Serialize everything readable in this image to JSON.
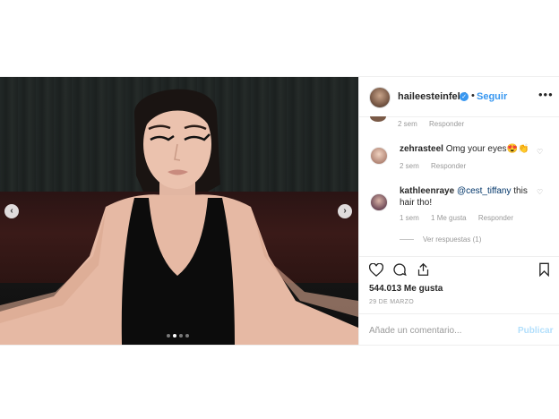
{
  "header": {
    "username": "haileesteinfeld",
    "separator": "•",
    "follow_label": "Seguir",
    "more_label": "•••"
  },
  "comments": {
    "previous": {
      "time": "2 sem",
      "reply_label": "Responder"
    },
    "items": [
      {
        "username": "zehrasteel",
        "text": "Omg your eyes😍👏",
        "time": "2 sem",
        "reply_label": "Responder"
      },
      {
        "username": "kathleenraye",
        "mention": "@cest_tiffany",
        "text": " this hair tho!",
        "time": "1 sem",
        "likes": "1 Me gusta",
        "reply_label": "Responder"
      }
    ],
    "view_replies": "Ver respuestas (1)"
  },
  "actions": {
    "likes": "544.013 Me gusta",
    "date": "29 DE MARZO"
  },
  "add_comment": {
    "placeholder": "Añade un comentario...",
    "publish_label": "Publicar"
  },
  "carousel": {
    "slides": 4,
    "active": 2
  },
  "colors": {
    "accent": "#3897f0",
    "muted": "#999999",
    "text": "#262626",
    "disabled_button": "#b2dffc"
  }
}
